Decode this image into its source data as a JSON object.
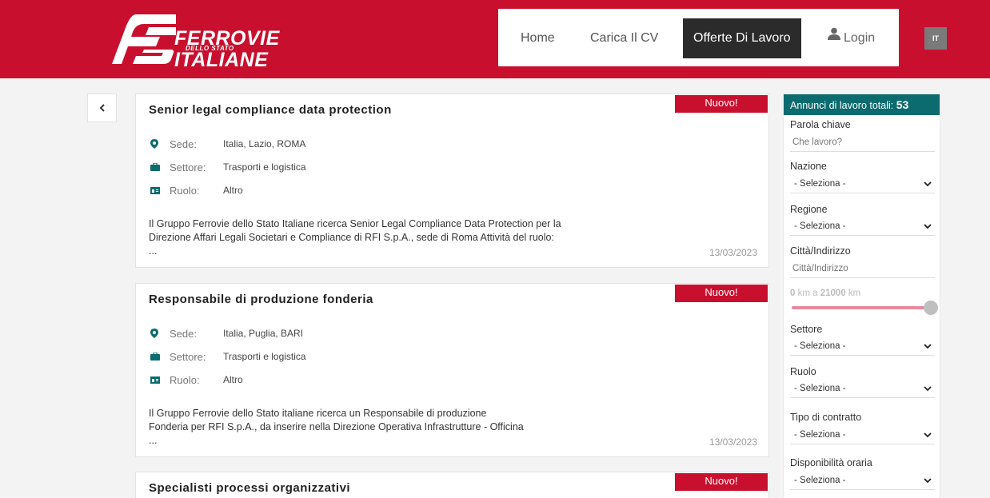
{
  "brand": {
    "line1": "FERROVIE",
    "sub": "DELLO STATO",
    "line2": "ITALIANE"
  },
  "nav": {
    "home": "Home",
    "cv": "Carica Il CV",
    "offerte": "Offerte Di Lavoro",
    "login": "Login",
    "lang": "IT"
  },
  "jobs": [
    {
      "badge": "Nuovo!",
      "title": "Senior legal compliance data protection",
      "sede_label": "Sede:",
      "sede": "Italia, Lazio, ROMA",
      "settore_label": "Settore:",
      "settore": "Trasporti e logistica",
      "ruolo_label": "Ruolo:",
      "ruolo": "Altro",
      "desc1": "Il Gruppo Ferrovie dello Stato Italiane ricerca Senior Legal Compliance Data Protection per la",
      "desc2": "Direzione Affari Legali Societari e Compliance di RFI S.p.A., sede di Roma   Attività del ruolo:",
      "desc3": "...",
      "date": "13/03/2023"
    },
    {
      "badge": "Nuovo!",
      "title": "Responsabile di produzione fonderia",
      "sede_label": "Sede:",
      "sede": "Italia, Puglia, BARI",
      "settore_label": "Settore:",
      "settore": "Trasporti e logistica",
      "ruolo_label": "Ruolo:",
      "ruolo": "Altro",
      "desc1": "Il Gruppo Ferrovie dello Stato italiane ricerca un Responsabile di produzione",
      "desc2": "Fonderia per RFI S.p.A., da inserire nella Direzione Operativa Infrastrutture - Officina",
      "desc3": "...",
      "date": "13/03/2023"
    },
    {
      "badge": "Nuovo!",
      "title": "Specialisti processi organizzativi"
    }
  ],
  "sidebar": {
    "total_label": "Annunci di lavoro totali:",
    "total": "53",
    "keyword_label": "Parola chiave",
    "keyword_placeholder": "Che lavoro?",
    "nazione_label": "Nazione",
    "nazione_value": "- Seleziona -",
    "regione_label": "Regione",
    "regione_value": "- Seleziona -",
    "citta_label": "Città/Indirizzo",
    "citta_placeholder": "Città/Indirizzo",
    "range_min": "0",
    "range_mid": "km a",
    "range_max": "21000",
    "range_unit": "km",
    "settore_label": "Settore",
    "settore_value": "- Seleziona -",
    "ruolo_label": "Ruolo",
    "ruolo_value": "- Seleziona -",
    "contratto_label": "Tipo di contratto",
    "contratto_value": "- Seleziona -",
    "orario_label": "Disponibilità oraria",
    "orario_value": "- Seleziona -"
  },
  "colors": {
    "brand_red": "#c8102e",
    "teal": "#0b6b6e",
    "nav_active": "#2b2b2b"
  }
}
